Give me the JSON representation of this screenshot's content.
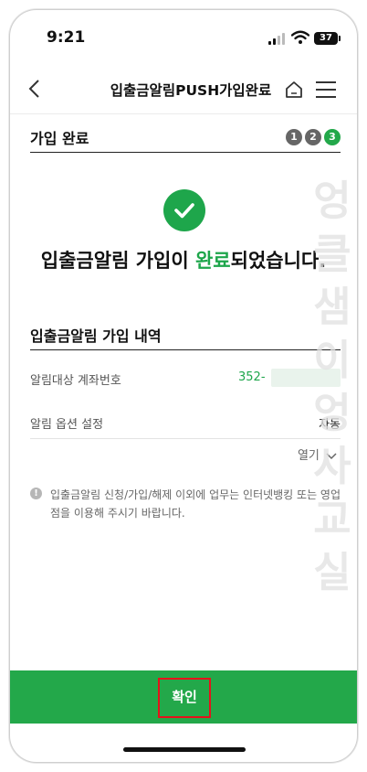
{
  "status": {
    "time": "9:21",
    "battery": "37"
  },
  "nav": {
    "title": "입출금알림PUSH가입완료"
  },
  "signup": {
    "section_title": "가입 완료",
    "steps": [
      "1",
      "2",
      "3"
    ]
  },
  "done": {
    "before": "입출금알림 가입이 ",
    "highlight": "완료",
    "after": "되었습니다."
  },
  "history": {
    "title": "입출금알림 가입 내역",
    "rows": [
      {
        "label": "알림대상 계좌번호",
        "value": "352-"
      },
      {
        "label": "알림 옵션 설정",
        "value": "자동"
      }
    ],
    "more": "열기"
  },
  "notice": "입출금알림 신청/가입/해제 이외에 업무는 인터넷뱅킹 또는 영업점을 이용해 주시기 바랍니다.",
  "watermark": "엉클샘이 엉사교실",
  "confirm": "확인",
  "colors": {
    "accent": "#23a84a",
    "highlight": "#e5121b"
  }
}
